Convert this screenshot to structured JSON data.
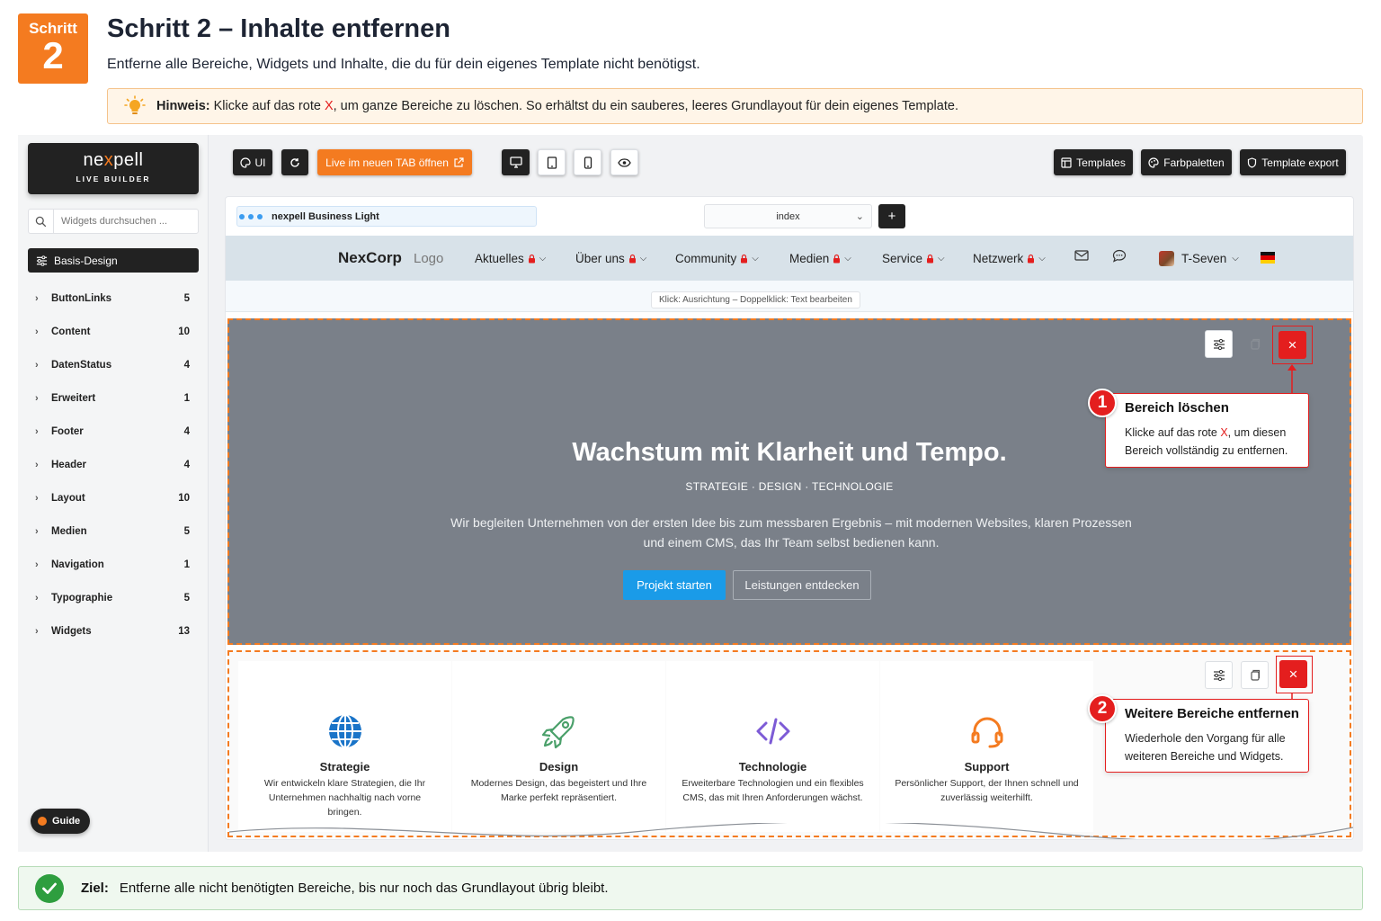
{
  "step": {
    "badge_label": "Schritt",
    "badge_number": "2",
    "title": "Schritt 2 – Inhalte entfernen",
    "description": "Entferne alle Bereiche, Widgets und Inhalte, die du für dein eigenes Template nicht benötigst."
  },
  "hint": {
    "label": "Hinweis:",
    "text_before": "Klicke auf das rote",
    "red_x": "X",
    "text_after": ", um ganze Bereiche zu löschen. So erhältst du ein sauberes, leeres Grundlayout für dein eigenes Template."
  },
  "sidebar": {
    "brand_prefix": "ne",
    "brand_x": "x",
    "brand_suffix": "pell",
    "brand_sub": "LIVE BUILDER",
    "search_placeholder": "Widgets durchsuchen ...",
    "active_item": "Basis-Design",
    "categories": [
      {
        "label": "ButtonLinks",
        "count": "5"
      },
      {
        "label": "Content",
        "count": "10"
      },
      {
        "label": "DatenStatus",
        "count": "4"
      },
      {
        "label": "Erweitert",
        "count": "1"
      },
      {
        "label": "Footer",
        "count": "4"
      },
      {
        "label": "Header",
        "count": "4"
      },
      {
        "label": "Layout",
        "count": "10"
      },
      {
        "label": "Medien",
        "count": "5"
      },
      {
        "label": "Navigation",
        "count": "1"
      },
      {
        "label": "Typographie",
        "count": "5"
      },
      {
        "label": "Widgets",
        "count": "13"
      }
    ],
    "guide_label": "Guide"
  },
  "toolbar": {
    "ui_label": "UI",
    "live_tab_label": "Live im neuen TAB öffnen",
    "templates_label": "Templates",
    "palettes_label": "Farbpaletten",
    "export_label": "Template export"
  },
  "preview": {
    "site_name": "nexpell Business Light",
    "page_select": "index",
    "add_label": "+",
    "nav": {
      "logo": "NexCorp",
      "logo_text": "Logo",
      "items": [
        "Aktuelles",
        "Über uns",
        "Community",
        "Medien",
        "Service",
        "Netzwerk"
      ],
      "user": "T-Seven"
    },
    "edit_hint": "Klick: Ausrichtung – Doppelklick: Text bearbeiten",
    "hero": {
      "title": "Wachstum mit Klarheit und Tempo.",
      "kicker": "STRATEGIE · DESIGN · TECHNOLOGIE",
      "lead": "Wir begleiten Unternehmen von der ersten Idee bis zum messbaren Ergebnis – mit modernen Websites, klaren Prozessen und einem CMS, das Ihr Team selbst bedienen kann.",
      "cta_primary": "Projekt starten",
      "cta_secondary": "Leistungen entdecken",
      "delete_symbol": "×"
    },
    "features": [
      {
        "icon": "globe-icon",
        "title": "Strategie",
        "text": "Wir entwickeln klare Strategien, die Ihr Unternehmen nachhaltig nach vorne bringen."
      },
      {
        "icon": "rocket-icon",
        "title": "Design",
        "text": "Modernes Design, das begeistert und Ihre Marke perfekt repräsentiert."
      },
      {
        "icon": "code-icon",
        "title": "Technologie",
        "text": "Erweiterbare Technologien und ein flexibles CMS, das mit Ihren Anforderungen wächst."
      },
      {
        "icon": "headset-icon",
        "title": "Support",
        "text": "Persönlicher Support, der Ihnen schnell und zuverlässig weiterhilft."
      }
    ]
  },
  "callouts": [
    {
      "number": "1",
      "title": "Bereich löschen",
      "text_before": "Klicke auf das rote",
      "red": "X",
      "text_after": ", um diesen Bereich vollständig zu entfernen."
    },
    {
      "number": "2",
      "title": "Weitere Bereiche entfernen",
      "text": "Wiederhole den Vorgang für alle weiteren Bereiche und Widgets."
    }
  ],
  "goal": {
    "label": "Ziel:",
    "text": "Entferne alle nicht benötigten Bereiche, bis nur noch das Grundlayout übrig bleibt."
  },
  "colors": {
    "accent": "#f47b20",
    "danger": "#e41e1e",
    "primary_button": "#1a9be8",
    "success": "#2e9e3f"
  }
}
